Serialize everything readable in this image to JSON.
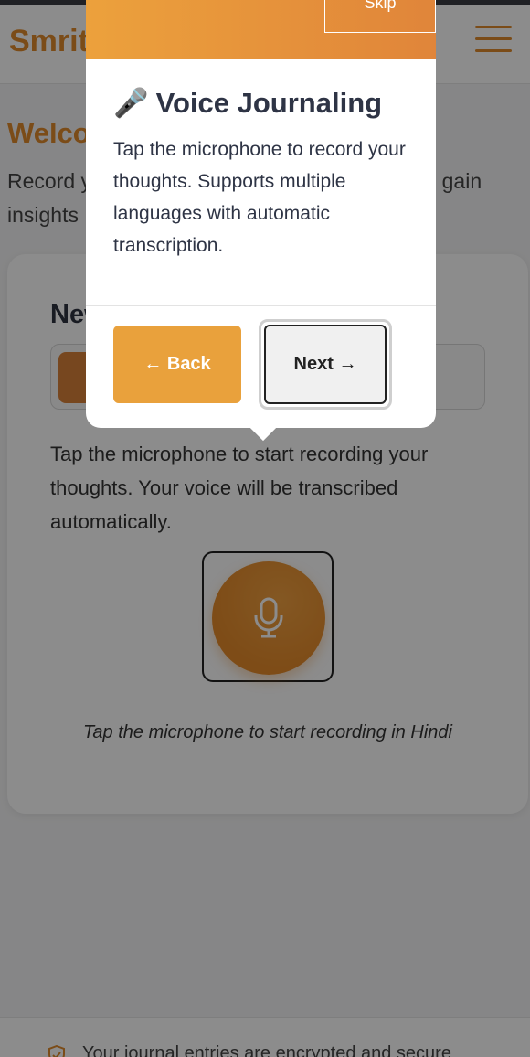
{
  "header": {
    "brand": "Smriti"
  },
  "welcome": {
    "title": "Welcome",
    "text": "Record your daily thoughts and let AI help you gain insights"
  },
  "card": {
    "title": "New Entry",
    "description": "Tap the microphone to start recording your thoughts. Your voice will be transcribed automatically.",
    "mic_hint": "Tap the microphone to start recording in Hindi"
  },
  "footer": {
    "text": "Your journal entries are encrypted and secure"
  },
  "tour": {
    "skip_label": "Skip",
    "emoji": "🎤",
    "title": "Voice Journaling",
    "body": "Tap the microphone to record your thoughts. Supports multiple languages with automatic transcription.",
    "back_label": "← Back",
    "next_label": "Next →"
  },
  "colors": {
    "accent": "#e08a2c",
    "button_orange": "#e9a13c"
  },
  "icons": [
    "menu-icon",
    "microphone-icon",
    "shield-check-icon"
  ]
}
